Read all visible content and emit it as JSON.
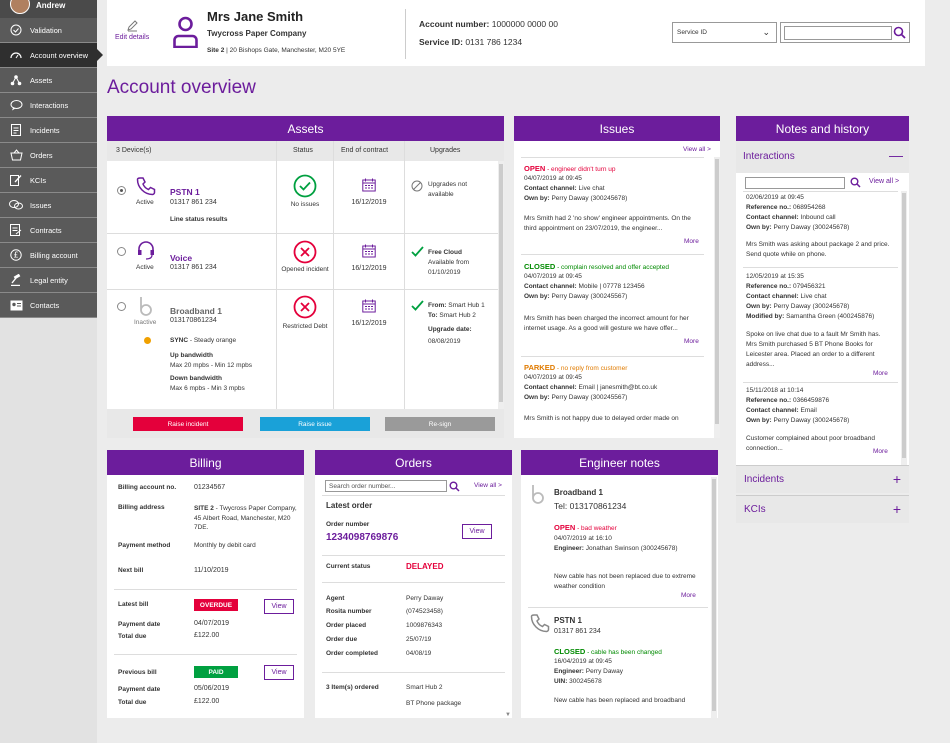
{
  "sidebar": {
    "user": "Andrew",
    "items": [
      {
        "label": "Validation"
      },
      {
        "label": "Account overview"
      },
      {
        "label": "Assets"
      },
      {
        "label": "Interactions"
      },
      {
        "label": "Incidents"
      },
      {
        "label": "Orders"
      },
      {
        "label": "KCIs"
      },
      {
        "label": "Issues"
      },
      {
        "label": "Contracts"
      },
      {
        "label": "Billing account"
      },
      {
        "label": "Legal entity"
      },
      {
        "label": "Contacts"
      }
    ]
  },
  "header": {
    "edit_label": "Edit details",
    "customer_name": "Mrs Jane Smith",
    "company": "Twycross Paper Company",
    "site_label": "Site 2",
    "site_address": " | 20 Bishops Gate, Manchester, M20 5YE",
    "account_label": "Account number:",
    "account_value": "1000000 0000 00",
    "service_label": "Service ID:",
    "service_value": "0131 786 1234",
    "select_value": "Service ID",
    "colors": {
      "accent": "#6c1d9c"
    }
  },
  "page_title": "Account overview",
  "assets": {
    "title": "Assets",
    "cols": {
      "devices": "3 Device(s)",
      "status": "Status",
      "end": "End of contract",
      "upgrades": "Upgrades"
    },
    "rows": [
      {
        "name": "PSTN 1",
        "number": "01317 861 234",
        "state": "Active",
        "extra": "Line status results",
        "status": "No issues",
        "end": "16/12/2019",
        "upgrade": "Upgrades not available"
      },
      {
        "name": "Voice",
        "number": "01317 861 234",
        "state": "Active",
        "status": "Opened incident",
        "end": "16/12/2019",
        "upgrade_title": "Free Cloud",
        "upgrade_text": "Available from 01/10/2019"
      },
      {
        "name": "Broadband 1",
        "number": "013170861234",
        "state": "Inactive",
        "sync_label": "SYNC",
        "sync_value": " - Steady orange",
        "up_label": "Up bandwidth",
        "up_value": "Max 20 mpbs - Min 12 mpbs",
        "down_label": "Down bandwidth",
        "down_value": "Max  6 mpbs - Min 3 mpbs",
        "status": "Restricted Debt",
        "end": "16/12/2019",
        "from_label": "From:",
        "from_value": " Smart Hub 1",
        "to_label": "To:",
        "to_value": " Smart Hub 2",
        "date_label": "Upgrade date:",
        "date_value": "08/08/2019"
      }
    ],
    "buttons": {
      "raise_incident": "Raise incident",
      "raise_issue": "Raise issue",
      "resign": "Re-sign"
    }
  },
  "issues": {
    "title": "Issues",
    "view_all": "View all >",
    "items": [
      {
        "status": "OPEN",
        "reason": " - engineer didn't turn up",
        "date": "04/07/2019 at 09:45",
        "channel_label": "Contact channel:",
        "channel": " Live chat",
        "owner_label": "Own by:",
        "owner": " Perry Daway (300245678)",
        "text": "Mrs Smith  had 2 'no show' engineer appointments. On the third appointment on 23/07/2019, the engineer...",
        "more": "More"
      },
      {
        "status": "CLOSED",
        "reason": " - complain resolved and offer accepted",
        "date": "04/07/2019 at 09:45",
        "channel_label": "Contact channel:",
        "channel": " Mobile  |  07778 123456",
        "owner_label": "Own by:",
        "owner": " Perry Daway (300245567)",
        "text": "Mrs Smith has been charged the incorrect amount for her internet usage. As a good will gesture we have offer...",
        "more": "More"
      },
      {
        "status": "PARKED",
        "reason": " - no reply from customer",
        "date": "04/07/2019 at 09:45",
        "channel_label": "Contact channel:",
        "channel": " Email  |  janesmith@bt.co.uk",
        "owner_label": "Own by:",
        "owner": " Perry Daway (300245567)",
        "text": "Mrs Smith is not happy due to delayed order made on"
      }
    ]
  },
  "notes": {
    "title": "Notes and history",
    "interactions_label": "Interactions",
    "view_all": "View all >",
    "items": [
      {
        "date": "02/06/2019 at 09:45",
        "ref_label": "Reference no.:",
        "ref": " 068954268",
        "channel_label": "Contact channel:",
        "channel": " Inbound call",
        "owner_label": "Own by:",
        "owner": " Perry Daway (300245678)",
        "text": "Mrs Smith was asking about package 2 and price. Send quote while on phone."
      },
      {
        "date": "12/05/2019 at 15:35",
        "ref_label": "Reference no.:",
        "ref": " 079456321",
        "channel_label": "Contact channel:",
        "channel": " Live chat",
        "owner_label": "Own by:",
        "owner": " Perry Daway (300245678)",
        "mod_label": "Modified by:",
        "mod": " Samantha Green (400245876)",
        "text": "Spoke on live chat due to a fault Mr Smith has. Mrs Smith purchased 5 BT Phone Books for Leicester area. Placed an order to a different address...",
        "more": "More"
      },
      {
        "date": "15/11/2018 at 10:14",
        "ref_label": "Reference no.:",
        "ref": " 0366459876",
        "channel_label": "Contact channel:",
        "channel": " Email",
        "owner_label": "Own by:",
        "owner": " Perry Daway (300245678)",
        "text": "Customer complained about poor broadband connection...",
        "more": "More"
      }
    ],
    "incidents_label": "Incidents",
    "kcis_label": "KCIs"
  },
  "billing": {
    "title": "Billing",
    "account_label": "Billing account no.",
    "account_value": "01234567",
    "address_label": "Billing address",
    "address_site": "SITE 2",
    "address_value": " - Twycross Paper Company, 45 Albert Road, Manchester, M20 7DE.",
    "method_label": "Payment method",
    "method_value": "Monthly by debit card",
    "next_label": "Next bill",
    "next_value": "11/10/2019",
    "latest_label": "Latest bill",
    "latest_badge": "OVERDUE",
    "latest_pay_label": "Payment date",
    "latest_pay": "04/07/2019",
    "latest_total_label": "Total due",
    "latest_total": "£122.00",
    "prev_label": "Previous bill",
    "prev_badge": "PAID",
    "prev_pay_label": "Payment date",
    "prev_pay": "05/06/2019",
    "prev_total_label": "Total due",
    "prev_total": "£122.00",
    "view": "View"
  },
  "orders": {
    "title": "Orders",
    "search_placeholder": "Search order number...",
    "view_all": "View all >",
    "latest_label": "Latest order",
    "number_label": "Order number",
    "number_value": "1234098769876",
    "view": "View",
    "status_label": "Current status",
    "status_value": "DELAYED",
    "agent_label": "Agent",
    "agent_value": "Perry Daway",
    "rosita_label": "Rosita number",
    "rosita_value": "(074523458)",
    "placed_label": "Order placed",
    "placed_value": "1009876343",
    "due_label": "Order due",
    "due_value": "25/07/19",
    "completed_label": "Order completed",
    "completed_value": "04/08/19",
    "items_label": "3 Item(s) ordered",
    "item1": "Smart Hub 2",
    "item2": "BT Phone package"
  },
  "engineer": {
    "title": "Engineer notes",
    "items": [
      {
        "device": "Broadband 1",
        "tel": "Tel: 013170861234",
        "status": "OPEN",
        "reason": " - bad weather",
        "date": "04/07/2019 at 16:10",
        "eng_label": "Engineer:",
        "eng": " Jonathan Swinson (300245678)",
        "text": "New cable has not been replaced due to extreme weather condition",
        "more": "More"
      },
      {
        "device": "PSTN 1",
        "tel": "01317 861 234",
        "status": "CLOSED",
        "reason": " - cable has been changed",
        "date": "16/04/2019 at 09:45",
        "eng_label": "Engineer:",
        "eng": " Perry Daway",
        "uin_label": "UIN:",
        "uin": " 300245678",
        "text": "New cable has been replaced and broadband"
      }
    ]
  }
}
